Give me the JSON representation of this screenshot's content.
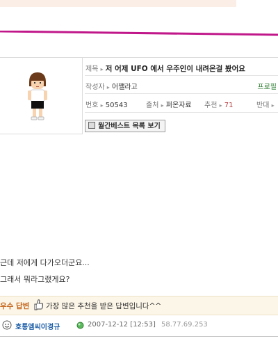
{
  "post": {
    "title_label": "제목",
    "title": "저 어제 UFO 에서 우주인이 내려온걸 봤어요",
    "author_label": "작성자",
    "author": "어쨀라고",
    "profile_link": "프로필",
    "number_label": "번호",
    "number": "50543",
    "source_label": "출처",
    "source": "퍼온자료",
    "recommend_label": "추천",
    "recommend_count": "71",
    "opposition_label": "반대",
    "monthly_best_button": "월간베스트 목록 보기"
  },
  "body_lines": [
    "근데 저에게 다가오더군요...",
    "그래서 뭐라그랬게요?"
  ],
  "best_answer": {
    "label": "우수 답변",
    "description": "가장 많은 추천을 받은 답변입니다^^"
  },
  "answer": {
    "author": "호통엠씨이경규",
    "datetime": "2007-12-12 [12:53]",
    "ip": "58.77.69.253"
  },
  "colors": {
    "accent_magenta": "#c0188a",
    "best_answer_orange": "#c4661c",
    "link_green": "#2e7d32",
    "answer_author_blue": "#1f5fa8"
  }
}
